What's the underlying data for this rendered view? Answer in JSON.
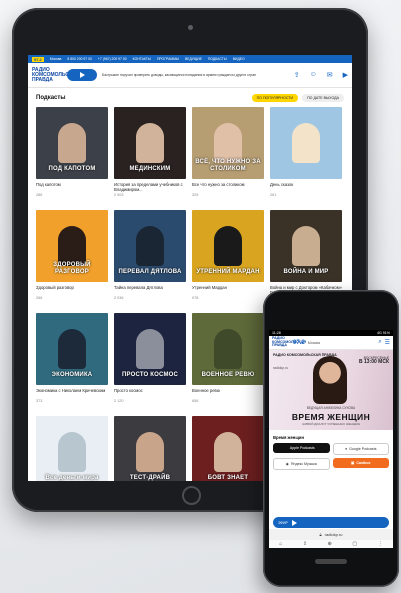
{
  "tablet": {
    "topbar": {
      "brand": "97.2",
      "items": [
        "Москва",
        "8 800 200 97 00",
        "+7 (967) 200 97 00",
        "КОНТАКТЫ",
        "ПРОГРАММЫ",
        "ВЕДУЩИЕ",
        "ПОДКАСТЫ",
        "ВИДЕО"
      ]
    },
    "header": {
      "logo": "РАДИО КОМСОМОЛЬСКАЯ ПРАВДА",
      "now_playing": "Бастрыкин поручил проверить доводы, касающиеся попадания в армию граждан из других стран",
      "icons": [
        "share-icon",
        "user-icon",
        "mail-icon",
        "video-icon"
      ]
    },
    "section_title": "Подкасты",
    "filters": {
      "active": "ПО ПОПУЛЯРНОСТИ",
      "inactive": "ПО ДАТЕ ВЫХОДА"
    },
    "cards": [
      {
        "title": "Под капотом",
        "count": "286",
        "banner": "ПОД КАПОТОМ",
        "bg": "#3c4048",
        "fig": "#c7a78d"
      },
      {
        "title": "История за пределами учебников с Владимиром...",
        "count": "2 003",
        "banner": "МЕДИНСКИМ",
        "bg": "#2a2220",
        "fig": "#d1b29a"
      },
      {
        "title": "Все что нужно за столиком",
        "count": "325",
        "banner": "ВСЁ, ЧТО НУЖНО ЗА СТОЛИКОМ",
        "bg": "#b79d72",
        "fig": "#e0c0a6"
      },
      {
        "title": "День сказок",
        "count": "261",
        "banner": "",
        "bg": "#9fc6e3",
        "fig": "#f3e3c8"
      },
      {
        "title": "Здоровый разговор",
        "count": "266",
        "banner": "ЗДОРОВЫЙ РАЗГОВОР",
        "bg": "#f0a02b",
        "fig": "#2a1d18"
      },
      {
        "title": "Тайна перевала Дятлова",
        "count": "2 036",
        "banner": "ПЕРЕВАЛ ДЯТЛОВА",
        "bg": "#2b4b6e",
        "fig": "#1a2633"
      },
      {
        "title": "Утренний Мардан",
        "count": "978",
        "banner": "УТРЕННИЙ МАРДАН",
        "bg": "#d9a41f",
        "fig": "#1a1a1a"
      },
      {
        "title": "Война и мир с Доктором «Кабачком» Гурьевым",
        "count": "",
        "banner": "ВОЙНА И МИР",
        "bg": "#3a3227",
        "fig": "#c9ad90"
      },
      {
        "title": "Экономика с Николаем Кричевским",
        "count": "373",
        "banner": "ЭКОНОМИКА",
        "bg": "#2f6a7e",
        "fig": "#1d2a3a"
      },
      {
        "title": "Просто космос",
        "count": "2 120",
        "banner": "ПРОСТО КОСМОС",
        "bg": "#1d2440",
        "fig": "#8b8f9c"
      },
      {
        "title": "Военное ревю",
        "count": "656",
        "banner": "ВОЕННОЕ РЕВЮ",
        "bg": "#5e6a3a",
        "fig": "#3e4a2a"
      },
      {
        "title": "",
        "count": "",
        "banner": "",
        "bg": "#dfe6ec",
        "fig": "#dfe6ec"
      },
      {
        "title": "",
        "count": "",
        "banner": "Все деньги мира",
        "bg": "#e8eef3",
        "fig": "#b8c6cf"
      },
      {
        "title": "",
        "count": "",
        "banner": "ТЕСТ-ДРАЙВ",
        "bg": "#3b3b40",
        "fig": "#c8a48a"
      },
      {
        "title": "",
        "count": "",
        "banner": "БОВТ ЗНАЕТ",
        "bg": "#6d1f1f",
        "fig": "#d1b29a"
      },
      {
        "title": "",
        "count": "",
        "banner": "",
        "bg": "#ffffff",
        "fig": "#ffffff"
      }
    ]
  },
  "phone": {
    "status_left": "11:28",
    "status_right": "4G 91%",
    "logo": "РАДИО КОМСОМОЛЬСКАЯ ПРАВДА",
    "freq": "97.2",
    "city": "Москва",
    "banner": {
      "logo": "РАДИО КОМСОМОЛЬСКАЯ ПРАВДА",
      "site": "radiokp.ru",
      "day": "ВОСКРЕСЕНЬЕ",
      "time": "В 13:00 МСК",
      "host": "ВЕДУЩАЯ АНЖЕЛИКА СУХОВА",
      "title": "ВРЕМЯ ЖЕНЩИН",
      "subtitle": "ЖИВОЙ ДИАЛОГ УСПЕШНЫХ ЖЕНЩИН"
    },
    "section_title": "Время женщин",
    "badges": [
      "Apple Podcasts",
      "Google Podcasts",
      "Яндекс Музыка",
      "Castbox"
    ],
    "player_label": "ЭФИР",
    "url": "radiokp.ru",
    "nav_icons": [
      "home-icon",
      "share-icon",
      "plus-icon",
      "tabs-icon",
      "menu-icon"
    ]
  }
}
